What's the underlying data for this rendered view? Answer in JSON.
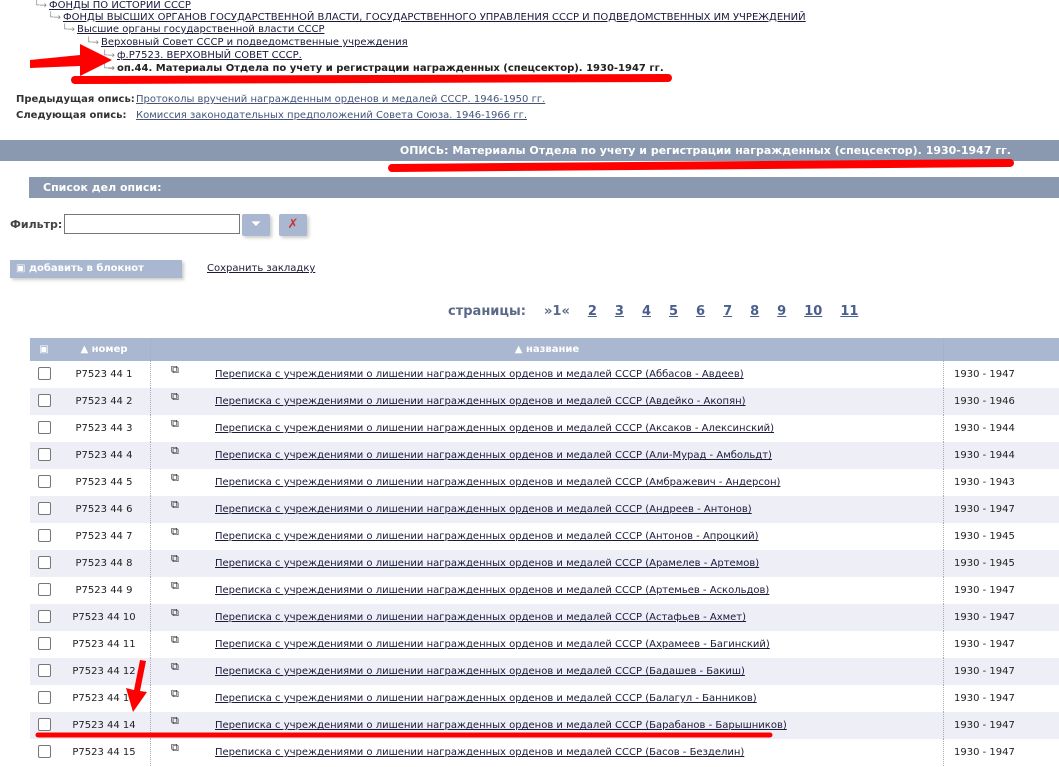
{
  "tree": [
    {
      "label": "ФОНДЫ ПО ИСТОРИИ СССР",
      "bold": false
    },
    {
      "label": "ФОНДЫ ВЫСШИХ ОРГАНОВ ГОСУДАРСТВЕННОЙ ВЛАСТИ, ГОСУДАРСТВЕННОГО УПРАВЛЕНИЯ СССР И ПОДВЕДОМСТВЕННЫХ ИМ УЧРЕЖДЕНИЙ"
    },
    {
      "label": "Высшие органы государственной власти СССР"
    },
    {
      "label": "Верховный Совет СССР и подведомственные учреждения"
    },
    {
      "label": "ф.Р7523. ВЕРХОВНЫЙ СОВЕТ СССР."
    },
    {
      "label": "оп.44. Материалы Отдела по учету и регистрации награжденных (спецсектор). 1930-1947 гг."
    }
  ],
  "nav": {
    "prev_label": "Предыдущая опись:",
    "prev_link": "Протоколы вручений награжденным орденов и медалей СССР. 1946-1950 гг.",
    "next_label": "Следующая опись:",
    "next_link": "Комиссия законодательных предположений Совета Союза. 1946-1966 гг."
  },
  "opis_title": "ОПИСЬ: Материалы Отдела по учету и регистрации награжденных (спецсектор). 1930-1947 гг.",
  "list_title": "Список дел описи:",
  "filter": {
    "label": "Фильтр:",
    "value": ""
  },
  "notebook_button": "добавить в блокнот",
  "bookmark_link": "Сохранить закладку",
  "pager": {
    "label": "страницы:",
    "current": "»1«",
    "pages": [
      "2",
      "3",
      "4",
      "5",
      "6",
      "7",
      "8",
      "9",
      "10",
      "11"
    ]
  },
  "table": {
    "col_number": "▲ номер",
    "col_title": "▲ название",
    "rows": [
      {
        "n": "Р7523 44 1",
        "t": "Переписка с учреждениями о лишении награжденных орденов и медалей СССР (Аббасов - Авдеев)",
        "y": "1930 - 1947"
      },
      {
        "n": "Р7523 44 2",
        "t": "Переписка с учреждениями о лишении награжденных орденов и медалей СССР (Авдейко - Акопян)",
        "y": "1930 - 1946"
      },
      {
        "n": "Р7523 44 3",
        "t": "Переписка с учреждениями о лишении награжденных орденов и медалей СССР (Аксаков - Алексинский)",
        "y": "1930 - 1944"
      },
      {
        "n": "Р7523 44 4",
        "t": "Переписка с учреждениями о лишении награжденных орденов и медалей СССР (Али-Мурад - Амбольдт)",
        "y": "1930 - 1944"
      },
      {
        "n": "Р7523 44 5",
        "t": "Переписка с учреждениями о лишении награжденных орденов и медалей СССР (Амбражевич - Андерсон)",
        "y": "1930 - 1943"
      },
      {
        "n": "Р7523 44 6",
        "t": "Переписка с учреждениями о лишении награжденных орденов и медалей СССР (Андреев - Антонов)",
        "y": "1930 - 1947"
      },
      {
        "n": "Р7523 44 7",
        "t": "Переписка с учреждениями о лишении награжденных орденов и медалей СССР (Антонов - Апроцкий)",
        "y": "1930 - 1945"
      },
      {
        "n": "Р7523 44 8",
        "t": "Переписка с учреждениями о лишении награжденных орденов и медалей СССР (Арамелев - Артемов)",
        "y": "1930 - 1945"
      },
      {
        "n": "Р7523 44 9",
        "t": "Переписка с учреждениями о лишении награжденных орденов и медалей СССР (Артемьев - Аскольдов)",
        "y": "1930 - 1947"
      },
      {
        "n": "Р7523 44 10",
        "t": "Переписка с учреждениями о лишении награжденных орденов и медалей СССР (Астафьев - Ахмет)",
        "y": "1930 - 1947"
      },
      {
        "n": "Р7523 44 11",
        "t": "Переписка с учреждениями о лишении награжденных орденов и медалей СССР (Ахрамеев - Багинский)",
        "y": "1930 - 1947"
      },
      {
        "n": "Р7523 44 12",
        "t": "Переписка с учреждениями о лишении награжденных орденов и медалей СССР (Бадашев - Бакиш)",
        "y": "1930 - 1947"
      },
      {
        "n": "Р7523 44 13",
        "t": "Переписка с учреждениями о лишении награжденных орденов и медалей СССР (Балагул - Банников)",
        "y": "1930 - 1947"
      },
      {
        "n": "Р7523 44 14",
        "t": "Переписка с учреждениями о лишении награжденных орденов и медалей СССР (Барабанов - Барышников)",
        "y": "1930 - 1947"
      },
      {
        "n": "Р7523 44 15",
        "t": "Переписка с учреждениями о лишении награжденных орденов и медалей СССР (Басов - Безделин)",
        "y": "1930 - 1947"
      }
    ]
  }
}
